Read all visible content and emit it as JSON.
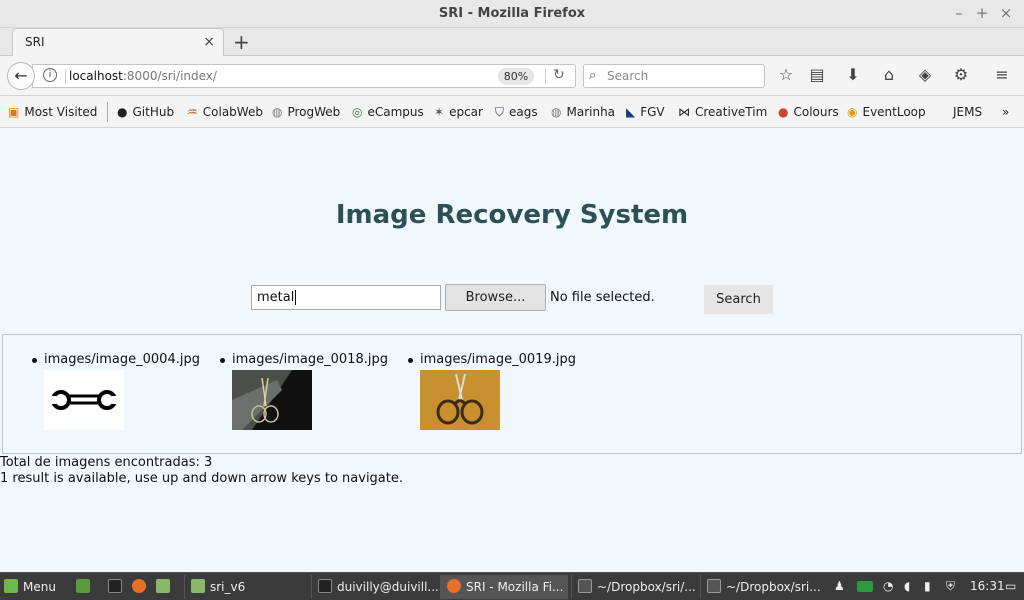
{
  "window": {
    "title": "SRI - Mozilla Firefox"
  },
  "tabs": [
    {
      "label": "SRI"
    }
  ],
  "navbar": {
    "url_host": "localhost",
    "url_path": ":8000/sri/index/",
    "zoom": "80%",
    "search_placeholder": "Search"
  },
  "bookmarks": [
    {
      "label": "Most Visited",
      "icon": "folder-icon"
    },
    {
      "label": "GitHub",
      "icon": "github-icon"
    },
    {
      "label": "ColabWeb",
      "icon": "colab-icon"
    },
    {
      "label": "ProgWeb",
      "icon": "globe-icon"
    },
    {
      "label": "eCampus",
      "icon": "ecampus-icon"
    },
    {
      "label": "epcar",
      "icon": "epcar-icon"
    },
    {
      "label": "eags",
      "icon": "eags-icon"
    },
    {
      "label": "Marinha",
      "icon": "globe-icon"
    },
    {
      "label": "FGV",
      "icon": "fgv-icon"
    },
    {
      "label": "CreativeTim",
      "icon": "creativetim-icon"
    },
    {
      "label": "Colours",
      "icon": "colours-icon"
    },
    {
      "label": "EventLoop",
      "icon": "eventloop-icon"
    },
    {
      "label": "JEMS",
      "icon": ""
    }
  ],
  "page": {
    "heading": "Image Recovery System",
    "search_value": "metal",
    "browse_label": "Browse...",
    "file_status": "No file selected.",
    "search_button": "Search",
    "results": [
      {
        "filename": "images/image_0004.jpg",
        "thumb": "wrench-drawing"
      },
      {
        "filename": "images/image_0018.jpg",
        "thumb": "scissors-on-dark"
      },
      {
        "filename": "images/image_0019.jpg",
        "thumb": "scissors-on-orange"
      }
    ],
    "total_text": "Total de imagens encontradas: 3",
    "autocomplete_text": "1 result is available, use up and down arrow keys to navigate."
  },
  "taskbar": {
    "menu_label": "Menu",
    "tasks": [
      {
        "label": "sri_v6",
        "icon": "folder-icon"
      },
      {
        "label": "duivilly@duivill...",
        "icon": "terminal-icon"
      },
      {
        "label": "SRI - Mozilla Fi...",
        "icon": "firefox-icon",
        "active": true
      },
      {
        "label": "~/Dropbox/sri/...",
        "icon": "sublime-icon"
      },
      {
        "label": "~/Dropbox/sri...",
        "icon": "sublime-icon"
      }
    ],
    "clock": "16:31"
  },
  "colors": {
    "heading": "#2d4f56",
    "page_bg": "#f0f7fd",
    "taskbar_bg": "#3b3b3b"
  }
}
